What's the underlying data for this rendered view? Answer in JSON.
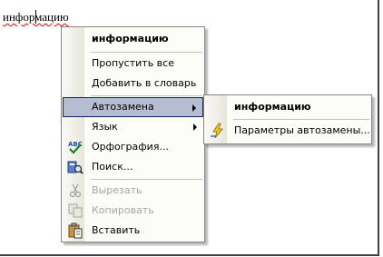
{
  "document": {
    "word": "информацию"
  },
  "context_menu": {
    "suggestion": "информацию",
    "ignore_all": "Пропустить все",
    "add_to_dictionary": "Добавить в словарь",
    "autocorrect": "Автозамена",
    "language": "Язык",
    "spelling": "Орфография...",
    "lookup": "Поиск...",
    "cut": "Вырезать",
    "copy": "Копировать",
    "paste": "Вставить"
  },
  "autocorrect_submenu": {
    "suggestion": "информацию",
    "options": "Параметры автозамены..."
  },
  "colors": {
    "highlight": "#b6bdd2",
    "highlight_border": "#0a246a",
    "disabled_text": "#a7a69e"
  },
  "icons": [
    "abc-check-icon",
    "search-book-icon",
    "scissors-icon",
    "copy-icon",
    "paste-clipboard-icon",
    "lightning-icon"
  ]
}
